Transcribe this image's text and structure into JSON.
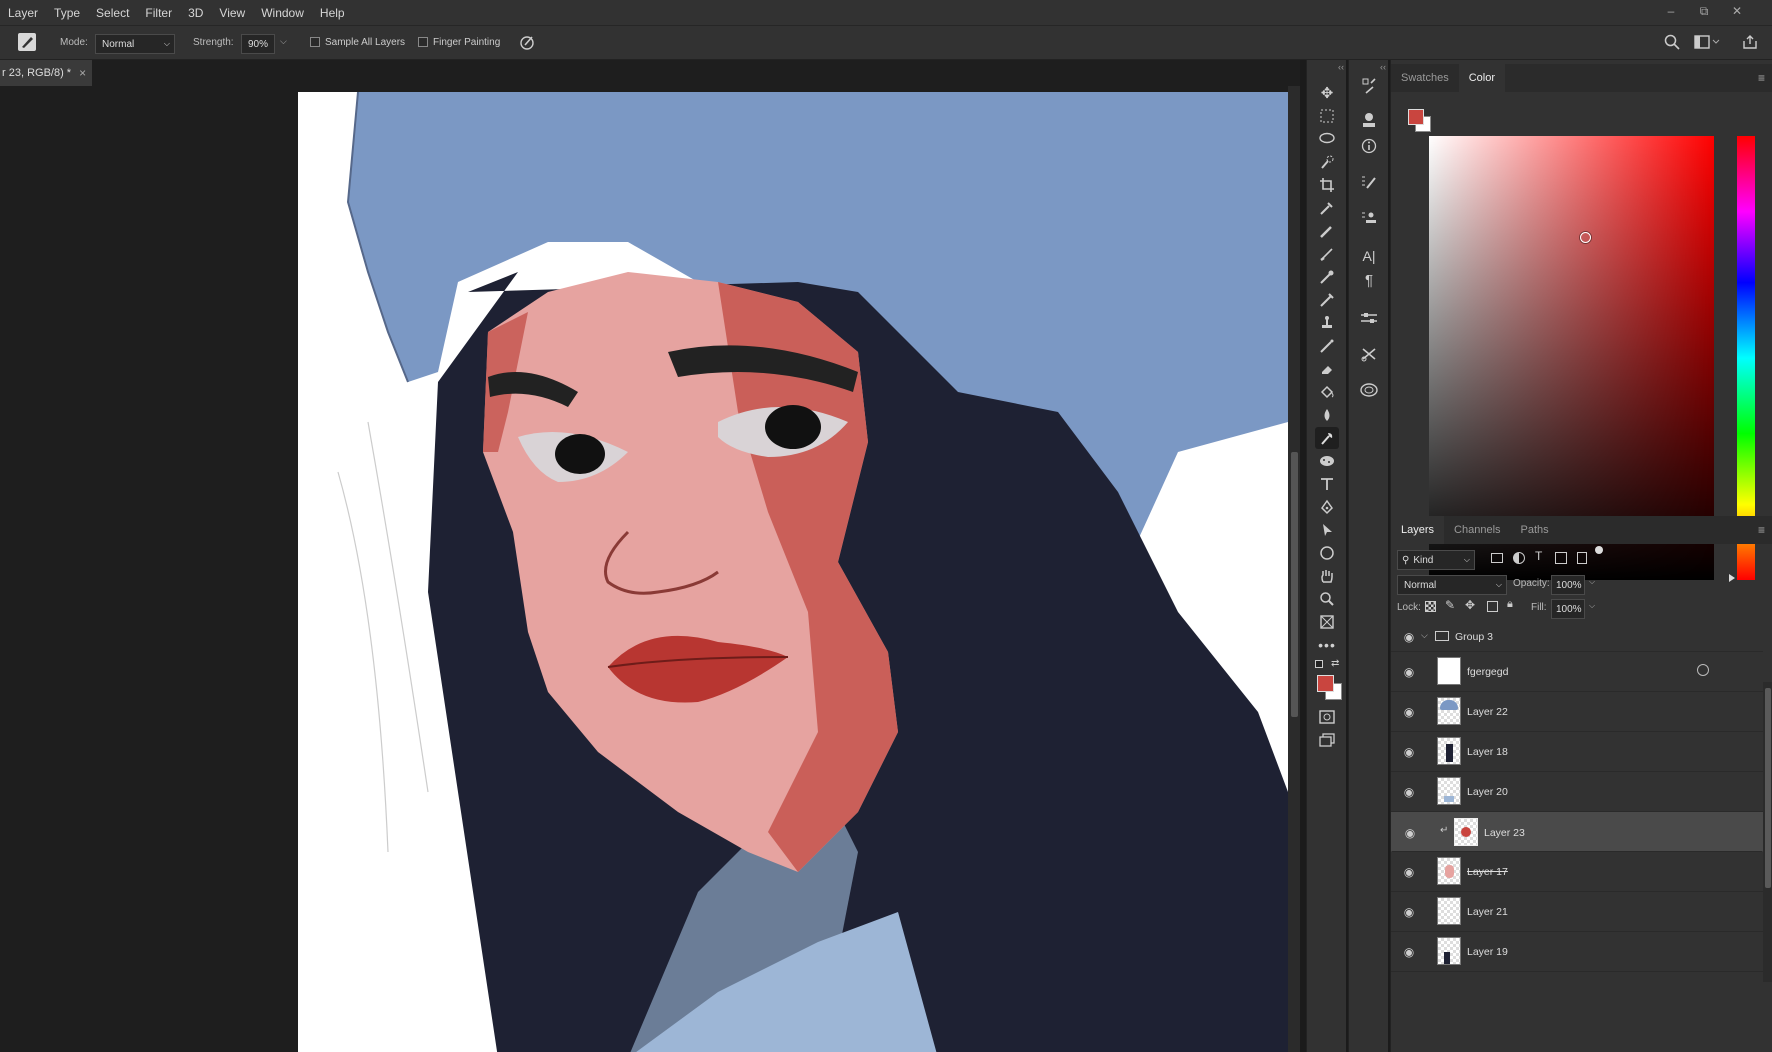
{
  "menu": [
    "Layer",
    "Type",
    "Select",
    "Filter",
    "3D",
    "View",
    "Window",
    "Help"
  ],
  "window_controls": {
    "minimize": "–",
    "restore": "⧉",
    "close": "✕"
  },
  "options": {
    "mode_label": "Mode:",
    "mode_value": "Normal",
    "strength_label": "Strength:",
    "strength_value": "90%",
    "sample_all_layers": "Sample All Layers",
    "finger_painting": "Finger Painting"
  },
  "document_tab": {
    "title": "r 23, RGB/8) *",
    "close": "×"
  },
  "color_panel": {
    "tabs": [
      "Swatches",
      "Color"
    ],
    "active_tab": "Color",
    "foreground": "#c9453f",
    "background": "#ffffff"
  },
  "layers_panel": {
    "tabs": [
      "Layers",
      "Channels",
      "Paths"
    ],
    "active_tab": "Layers",
    "filter_kind": "Kind",
    "blend_mode": "Normal",
    "opacity_label": "Opacity:",
    "opacity_value": "100%",
    "lock_label": "Lock:",
    "fill_label": "Fill:",
    "fill_value": "100%",
    "group": "Group 3",
    "layers": [
      {
        "name": "fgergegd",
        "selected": false,
        "strikethrough": false
      },
      {
        "name": "Layer 22",
        "selected": false,
        "strikethrough": false
      },
      {
        "name": "Layer 18",
        "selected": false,
        "strikethrough": false
      },
      {
        "name": "Layer 20",
        "selected": false,
        "strikethrough": false
      },
      {
        "name": "Layer 23",
        "selected": true,
        "strikethrough": false
      },
      {
        "name": "Layer 17",
        "selected": false,
        "strikethrough": true
      },
      {
        "name": "Layer 21",
        "selected": false,
        "strikethrough": false
      },
      {
        "name": "Layer 19",
        "selected": false,
        "strikethrough": false
      }
    ]
  },
  "toolbar_fg": "#c9453f",
  "colors": {
    "hat": "#7b98c4",
    "skin": "#e6a3a0",
    "skin_shadow": "#c4534c",
    "hair": "#1e2133",
    "lips": "#b83631"
  }
}
